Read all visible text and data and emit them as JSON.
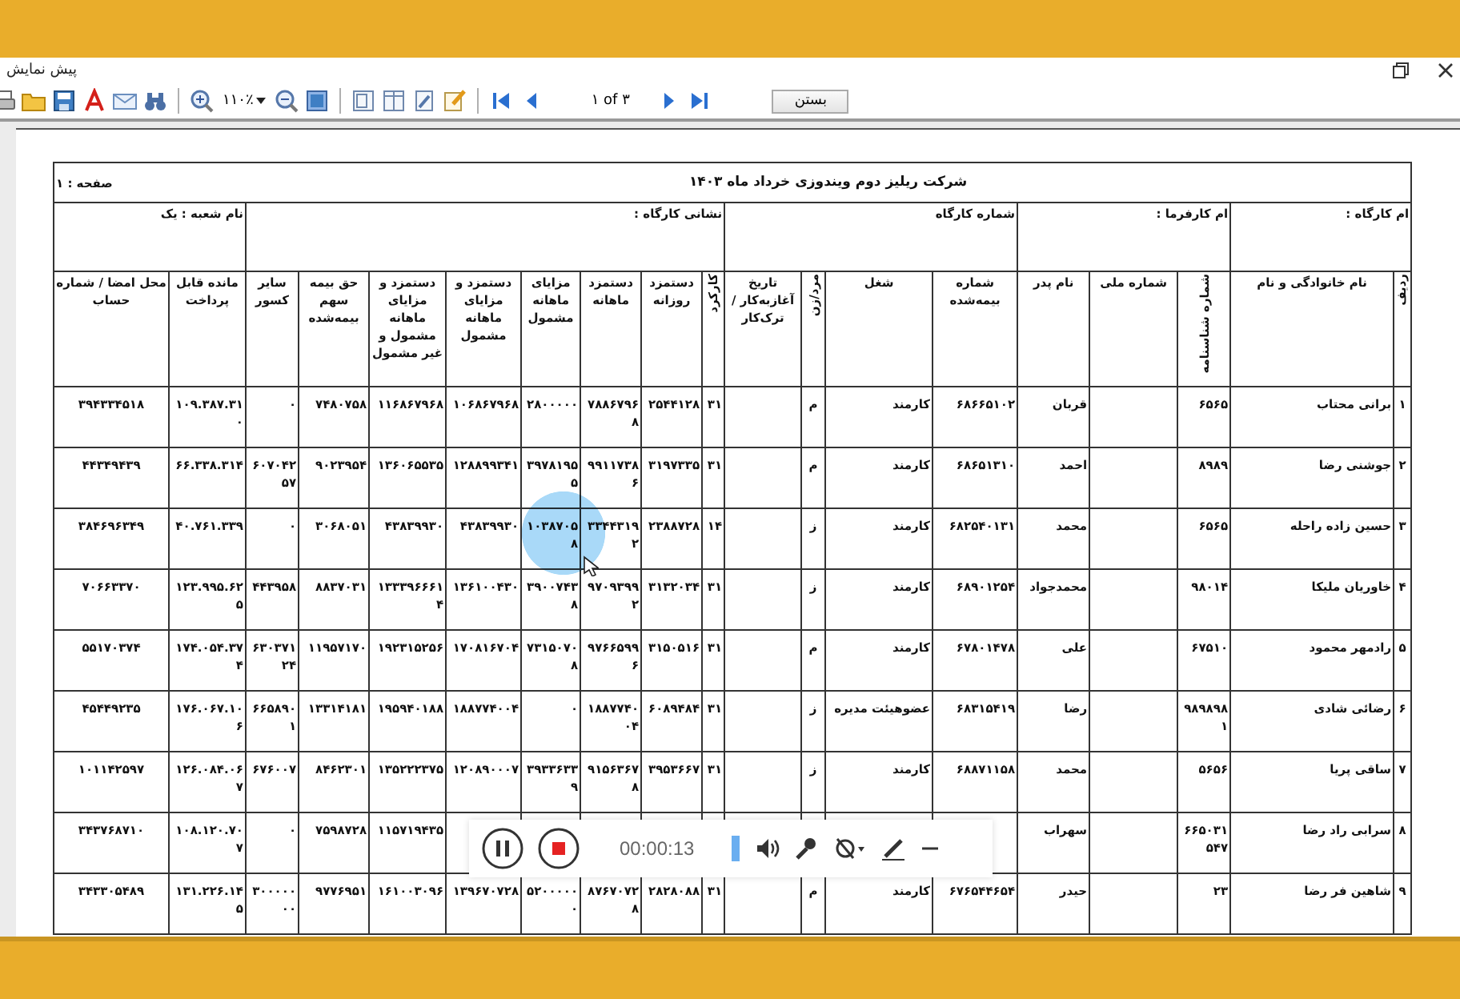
{
  "window": {
    "title": "پیش نمایش"
  },
  "toolbar": {
    "zoom": "۱۱۰٪",
    "page_indicator": "۱ of ۳",
    "close_button": "بستن"
  },
  "report": {
    "title": "شرکت ریلیز دوم ویندوزی خرداد ماه ۱۴۰۳",
    "page": "صفحه : ۱",
    "info": [
      "ام کارگاه :",
      "ام کارفرما :",
      "شماره کارگاه",
      "نشانی کارگاه :",
      "نام شعبه : یک"
    ],
    "columns": [
      "ردیف",
      "نام خانوادگی و نام",
      "شماره شناسنامه",
      "شماره ملی",
      "نام پدر",
      "شماره بیمه‌شده",
      "شغل",
      "مرد/زن",
      "تاریخ آغازبه‌کار / ترک‌کار",
      "کارکرد",
      "دستمزد روزانه",
      "دستمزد ماهانه",
      "مزایای ماهانه مشمول",
      "دستمزد و مزایای ماهانه مشمول",
      "دستمزد و مزایای ماهانه مشمول و غیر مشمول",
      "حق بیمه سهم بیمه‌شده",
      "سایر کسور",
      "مانده قابل پرداخت",
      "محل امضا / شماره حساب"
    ],
    "rows": [
      [
        "۱",
        "برانی محتاب",
        "۶۵۶۵",
        null,
        "قربان",
        "۶۸۶۶۵۱۰۲",
        "کارمند",
        "م",
        null,
        "۳۱",
        "۲۵۴۴۱۲۸",
        "۷۸۸۶۷۹۶۸",
        "۲۸۰۰۰۰۰",
        "۱۰۶۸۶۷۹۶۸",
        "۱۱۶۸۶۷۹۶۸",
        "۷۴۸۰۷۵۸",
        "۰",
        "۱۰۹.۳۸۷.۳۱۰",
        "۳۹۴۳۳۴۵۱۸"
      ],
      [
        "۲",
        "جوشنی رضا",
        "۸۹۸۹",
        null,
        "احمد",
        "۶۸۶۵۱۳۱۰",
        "کارمند",
        "م",
        null,
        "۳۱",
        "۳۱۹۷۳۳۵",
        "۹۹۱۱۷۳۸۶",
        "۳۹۷۸۱۹۵۵",
        "۱۲۸۸۹۹۳۴۱",
        "۱۳۶۰۶۵۵۳۵",
        "۹۰۲۳۹۵۴",
        "۶۰۷۰۴۲۵۷",
        "۶۶.۳۳۸.۳۱۴",
        "۴۴۳۴۹۴۳۹"
      ],
      [
        "۳",
        "حسین زاده راحله",
        "۶۵۶۵",
        null,
        "محمد",
        "۶۸۲۵۴۰۱۳۱",
        "کارمند",
        "ز",
        null,
        "۱۴",
        "۲۳۸۸۷۲۸",
        "۳۳۴۴۳۱۹۲",
        "۱۰۳۸۷۰۵۸",
        "۴۳۸۳۹۹۳۰",
        "۴۳۸۳۹۹۳۰",
        "۳۰۶۸۰۵۱",
        "۰",
        "۴۰.۷۶۱.۳۳۹",
        "۳۸۴۶۹۶۳۴۹"
      ],
      [
        "۴",
        "خاوریان ملیکا",
        "۹۸۰۱۴",
        null,
        "محمدجواد",
        "۶۸۹۰۱۲۵۴",
        "کارمند",
        "ز",
        null,
        "۳۱",
        "۳۱۳۲۰۳۴",
        "۹۷۰۹۳۹۹۲",
        "۳۹۰۰۷۴۳۸",
        "۱۳۶۱۰۰۴۳۰",
        "۱۳۳۳۹۶۶۶۱۴",
        "۸۸۳۷۰۳۱",
        "۴۴۳۹۵۸",
        "۱۲۳.۹۹۵.۶۲۵",
        "۷۰۶۶۳۳۷۰"
      ],
      [
        "۵",
        "رادمهر محمود",
        "۶۷۵۱۰",
        null,
        "علی",
        "۶۷۸۰۱۴۷۸",
        "کارمند",
        "م",
        null,
        "۳۱",
        "۳۱۵۰۵۱۶",
        "۹۷۶۶۵۹۹۶",
        "۷۳۱۵۰۷۰۸",
        "۱۷۰۸۱۶۷۰۴",
        "۱۹۲۳۱۵۲۵۶",
        "۱۱۹۵۷۱۷۰",
        "۶۳۰۳۷۱۲۴",
        "۱۷۴.۰۵۴.۳۷۴",
        "۵۵۱۷۰۳۷۴"
      ],
      [
        "۶",
        "رضائی شادی",
        "۹۸۹۸۹۸۱",
        null,
        "رضا",
        "۶۸۳۱۵۴۱۹",
        "عضوهیئت مدیره",
        "ز",
        null,
        "۳۱",
        "۶۰۸۹۴۸۴",
        "۱۸۸۷۷۴۰۰۴",
        "۰",
        "۱۸۸۷۷۴۰۰۴",
        "۱۹۵۹۴۰۱۸۸",
        "۱۳۳۱۴۱۸۱",
        "۶۶۵۸۹۰۱",
        "۱۷۶.۰۶۷.۱۰۶",
        "۴۵۴۴۹۲۳۵"
      ],
      [
        "۷",
        "ساقی پریا",
        "۵۶۵۶",
        null,
        "محمد",
        "۶۸۸۷۱۱۵۸",
        "کارمند",
        "ز",
        null,
        "۳۱",
        "۳۹۵۳۶۶۷",
        "۹۱۵۶۳۶۷۸",
        "۳۹۳۳۶۳۳۹",
        "۱۲۰۸۹۰۰۰۷",
        "۱۳۵۲۲۲۳۷۵",
        "۸۴۶۲۳۰۱",
        "۶۷۶۰۰۷",
        "۱۲۶.۰۸۴.۰۶۷",
        "۱۰۱۱۴۲۵۹۷"
      ],
      [
        "۸",
        "سرابی راد رضا",
        "۶۶۵۰۳۱۵۴۷",
        null,
        "سهراب",
        null,
        null,
        null,
        null,
        null,
        null,
        null,
        null,
        null,
        "۱۱۵۷۱۹۴۳۵",
        "۷۵۹۸۷۲۸",
        "۰",
        "۱۰۸.۱۲۰.۷۰۷",
        "۳۴۳۷۶۸۷۱۰"
      ],
      [
        "۹",
        "شاهین فر رضا",
        "۲۳",
        null,
        "حیدر",
        "۶۷۶۵۴۴۶۵۴",
        "کارمند",
        "م",
        null,
        "۳۱",
        "۲۸۲۸۰۸۸",
        "۸۷۶۷۰۷۲۸",
        "۵۲۰۰۰۰۰۰",
        "۱۳۹۶۷۰۷۲۸",
        "۱۶۱۰۰۳۰۹۶",
        "۹۷۷۶۹۵۱",
        "۳۰۰۰۰۰۰۰",
        "۱۳۱.۲۲۶.۱۴۵",
        "۳۴۳۳۰۵۴۸۹"
      ]
    ]
  },
  "recorder": {
    "time": "00:00:13"
  }
}
